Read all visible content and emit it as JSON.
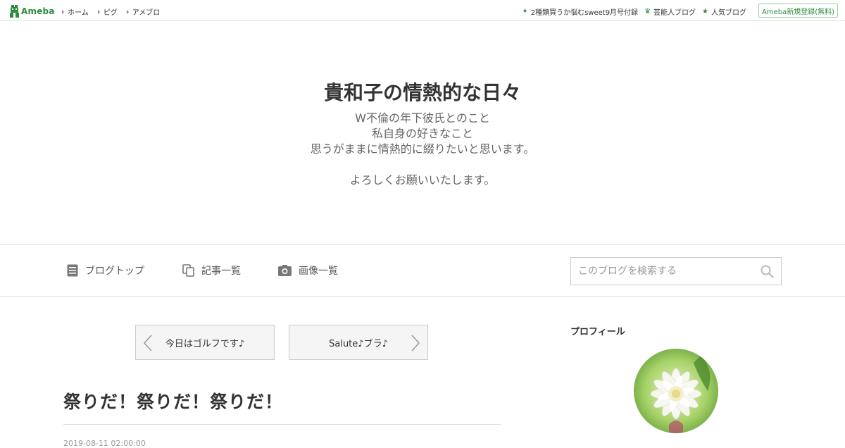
{
  "topbar": {
    "logo_text": "Ameba",
    "nav": [
      "ホーム",
      "ピグ",
      "アメブロ"
    ],
    "right_links": [
      {
        "icon": "sparkle-icon",
        "label": "2種類買うか悩むsweet9月号付録"
      },
      {
        "icon": "crown-icon",
        "label": "芸能人ブログ"
      },
      {
        "icon": "star-icon",
        "label": "人気ブログ"
      }
    ],
    "signup_label": "Ameba新規登録(無料)",
    "accent": "#2d8c3c"
  },
  "header": {
    "title": "貴和子の情熱的な日々",
    "description": [
      "W不倫の年下彼氏とのこと",
      "私自身の好きなこと",
      "思うがままに情熱的に綴りたいと思います。",
      "",
      "よろしくお願いいたします。"
    ]
  },
  "blognav": {
    "items": [
      {
        "icon": "document-icon",
        "label": "ブログトップ"
      },
      {
        "icon": "copy-icon",
        "label": "記事一覧"
      },
      {
        "icon": "camera-icon",
        "label": "画像一覧"
      }
    ],
    "search_placeholder": "このブログを検索する"
  },
  "pager": {
    "prev_label": "今日はゴルフです♪",
    "next_label": "Salute♪ブラ♪"
  },
  "entry": {
    "title": "祭りだ！祭りだ！祭りだ！",
    "date": "2019-08-11 02:00:00"
  },
  "sidebar": {
    "profile_heading": "プロフィール",
    "avatar_icon": "flower-avatar"
  }
}
